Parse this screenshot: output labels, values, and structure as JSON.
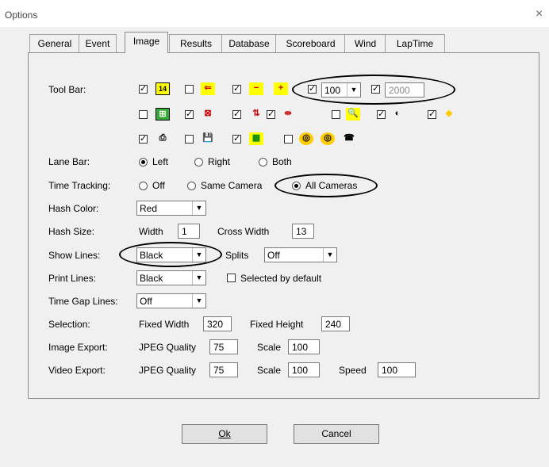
{
  "window": {
    "title": "Options",
    "close": "×"
  },
  "tabs": [
    "General",
    "Event",
    "Image",
    "Results",
    "Database",
    "Scoreboard",
    "Wind",
    "LapTime"
  ],
  "labels": {
    "tool_bar": "Tool Bar:",
    "lane_bar": "Lane Bar:",
    "time_tracking": "Time Tracking:",
    "hash_color": "Hash Color:",
    "hash_size": "Hash Size:",
    "show_lines": "Show Lines:",
    "print_lines": "Print Lines:",
    "time_gap_lines": "Time Gap Lines:",
    "selection": "Selection:",
    "image_export": "Image Export:",
    "video_export": "Video Export:"
  },
  "toolbar": {
    "zoom_value": "100",
    "frames_value": "2000",
    "icons": {
      "i1": "14",
      "i2": "⇐",
      "i3": "−",
      "i4": "+",
      "i5": "⊞",
      "i6": "⊠",
      "i7": "⇅",
      "i8": "⇹",
      "i9": "🔍",
      "i10": "◐",
      "i11": "◆",
      "i12": "⎙",
      "i13": "💾",
      "i14": "▦",
      "i15": "◎",
      "i16": "◎",
      "i17": "☎"
    }
  },
  "lane_bar": {
    "left": "Left",
    "right": "Right",
    "both": "Both"
  },
  "time_tracking": {
    "off": "Off",
    "same": "Same Camera",
    "all": "All Cameras"
  },
  "hash_color": "Red",
  "hash_size": {
    "width_label": "Width",
    "width": "1",
    "cross_label": "Cross Width",
    "cross": "13"
  },
  "show_lines": {
    "value": "Black",
    "splits_label": "Splits",
    "splits": "Off"
  },
  "print_lines": {
    "value": "Black",
    "selected_default": "Selected by default"
  },
  "time_gap_lines": "Off",
  "selection": {
    "fw_label": "Fixed Width",
    "fw": "320",
    "fh_label": "Fixed Height",
    "fh": "240"
  },
  "image_export": {
    "q_label": "JPEG Quality",
    "q": "75",
    "s_label": "Scale",
    "s": "100"
  },
  "video_export": {
    "q_label": "JPEG Quality",
    "q": "75",
    "s_label": "Scale",
    "s": "100",
    "sp_label": "Speed",
    "sp": "100"
  },
  "buttons": {
    "ok": "Ok",
    "cancel": "Cancel"
  },
  "check_mark": "✓",
  "combo_arrow": "▼"
}
